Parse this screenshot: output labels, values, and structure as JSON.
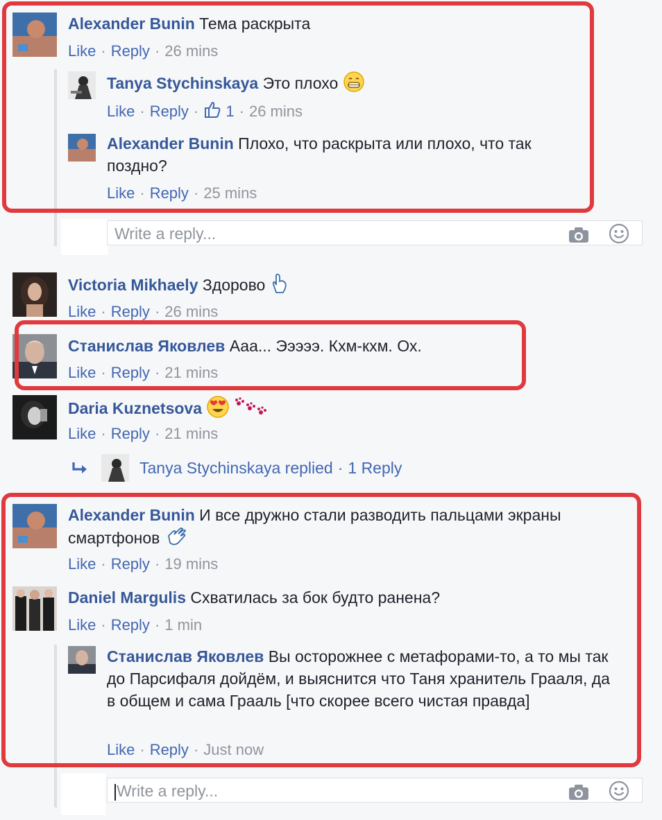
{
  "actions": {
    "like": "Like",
    "reply": "Reply",
    "sep": "·"
  },
  "comments": [
    {
      "name": "Alexander Bunin",
      "text": "Тема раскрыта",
      "time": "26 mins"
    },
    {
      "name": "Tanya Stychinskaya",
      "text": "Это плохо",
      "likes": "1",
      "time": "26 mins"
    },
    {
      "name": "Alexander Bunin",
      "text": "Плохо, что раскрыта или плохо, что так поздно?",
      "time": "25 mins"
    },
    {
      "name": "Victoria Mikhaely",
      "text": "Здорово",
      "time": "26 mins"
    },
    {
      "name": "Станислав Яковлев",
      "text": "Ааа... Эээээ. Кхм-кхм. Ох.",
      "time": "21 mins"
    },
    {
      "name": "Daria Kuznetsova",
      "text": "",
      "time": "21 mins"
    },
    {
      "name": "Alexander Bunin",
      "text": "И все дружно стали разводить пальцами экраны смартфонов",
      "time": "19 mins"
    },
    {
      "name": "Daniel Margulis",
      "text": "Схватилась за бок будто ранена?",
      "time": "1 min"
    },
    {
      "name": "Станислав Яковлев",
      "text": "Вы осторожнее с метафорами-то, а то мы так до Парсифаля дойдём, и выяснится что Таня хранитель Грааля, да в общем и сама Грааль [что скорее всего чистая правда]",
      "time": "Just now"
    }
  ],
  "replies_summary": {
    "text": "Tanya Stychinskaya replied",
    "count": "1 Reply"
  },
  "reply_input": {
    "placeholder": "Write a reply..."
  },
  "colors": {
    "link": "#365899",
    "highlight": "#e0393e",
    "meta": "#90949c"
  },
  "icons": [
    "camera-icon",
    "smiley-icon",
    "reply-arrow-icon",
    "like-thumb-icon"
  ]
}
